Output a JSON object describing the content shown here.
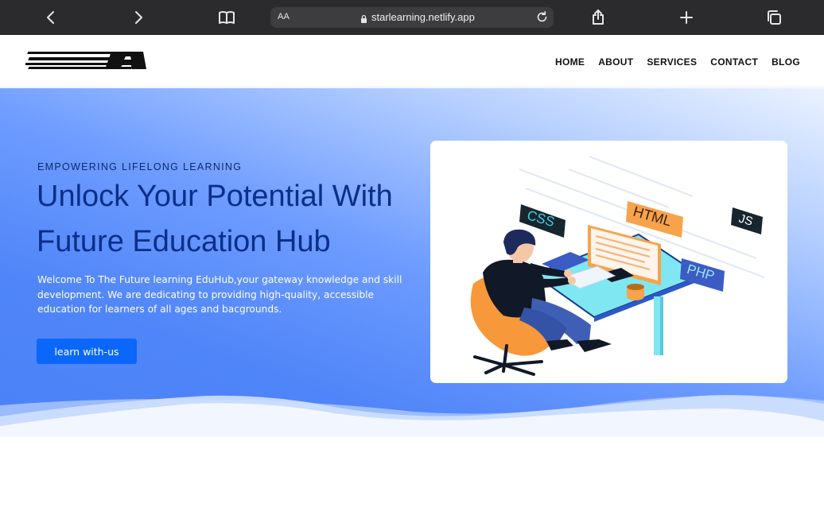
{
  "browser": {
    "text_size_label": "AA",
    "url": "starlearning.netlify.app"
  },
  "site": {
    "logo_text": "FUTURE",
    "nav": [
      {
        "label": "HOME"
      },
      {
        "label": "ABOUT"
      },
      {
        "label": "SERVICES"
      },
      {
        "label": "CONTACT"
      },
      {
        "label": "BLOG"
      }
    ]
  },
  "hero": {
    "eyebrow": "EMPOWERING LIFELONG LEARNING",
    "headline_line1": "Unlock Your Potential With",
    "headline_line2": "Future Education Hub",
    "intro": "Welcome To The Future learning EduHub,your gateway knowledge and skill development. We are dedicating to providing high-quality, accessible education for learners of all ages and bacgrounds.",
    "cta_label": "learn with-us"
  },
  "illustration": {
    "tags": {
      "css": "CSS",
      "html": "HTML",
      "js": "JS",
      "php": "PHP"
    }
  },
  "colors": {
    "chrome_bg": "#2b2b2d",
    "headline": "#0a2f8a",
    "cta_bg": "#0b66fa",
    "hero_blue": "#4f85f8"
  }
}
